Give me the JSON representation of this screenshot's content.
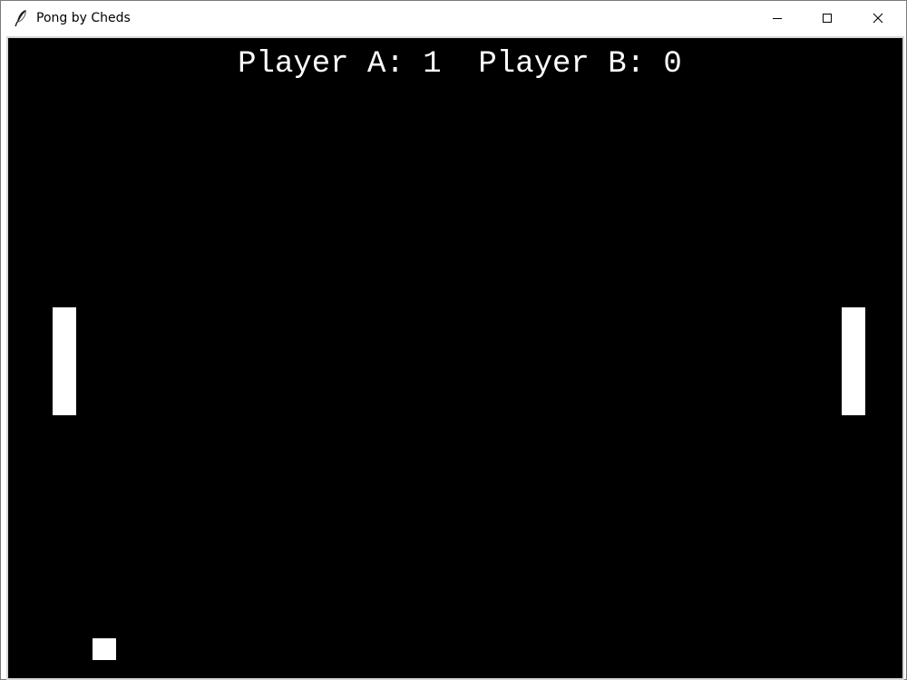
{
  "window": {
    "title": "Pong by Cheds",
    "icon": "feather-icon",
    "controls": {
      "minimize": "minimize-icon",
      "maximize": "maximize-icon",
      "close": "close-icon"
    }
  },
  "game": {
    "background_color": "#000000",
    "foreground_color": "#ffffff",
    "score_text": "Player A: 1  Player B: 0",
    "score": {
      "player_a": 1,
      "player_b": 0
    }
  }
}
